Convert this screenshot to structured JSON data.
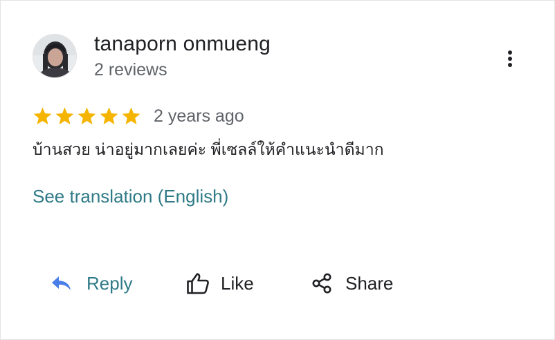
{
  "review": {
    "author": {
      "name": "tanaporn onmueng",
      "meta": "2 reviews"
    },
    "rating": 5,
    "date": "2 years ago",
    "text": "บ้านสวย น่าอยู่มากเลยค่ะ พี่เซลล์ให้คำแนะนำดีมาก",
    "translate_label": "See translation (English)"
  },
  "actions": {
    "reply_label": "Reply",
    "like_label": "Like",
    "share_label": "Share"
  },
  "icons": {
    "more": "more-vert-icon",
    "star": "star-icon",
    "reply": "reply-icon",
    "like": "thumb-up-icon",
    "share": "share-icon"
  },
  "colors": {
    "star": "#f4b400",
    "link": "#2f7a87",
    "reply_icon": "#4a7ee8",
    "text": "#202124",
    "secondary": "#5f6368"
  }
}
